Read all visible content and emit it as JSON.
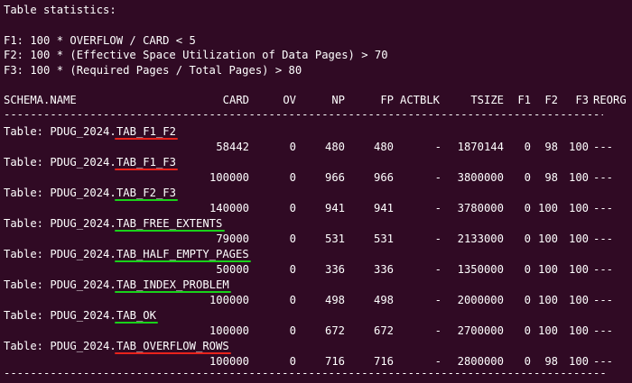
{
  "title": "Table statistics:",
  "formulas": [
    "F1: 100 * OVERFLOW / CARD < 5",
    "F2: 100 * (Effective Space Utilization of Data Pages) > 70",
    "F3: 100 * (Required Pages / Total Pages) > 80"
  ],
  "header": {
    "schema": "SCHEMA.NAME",
    "card": "CARD",
    "ov": "OV",
    "np": "NP",
    "fp": "FP",
    "actblk": "ACTBLK",
    "tsize": "TSIZE",
    "f1": "F1",
    "f2": "F2",
    "f3": "F3",
    "reorg": "REORG"
  },
  "separator": "-------------------------------------------------------------------------------------------",
  "colors": {
    "background": "#300a24",
    "text": "#ffffff",
    "fail_underline": "#e8231c",
    "ok_underline": "#19d21a"
  },
  "rows": [
    {
      "prefix": "Table: PDUG_2024.",
      "name": "TAB_F1_F2",
      "underline": "red",
      "card": "58442",
      "ov": "0",
      "np": "480",
      "fp": "480",
      "actblk": "-",
      "tsize": "1870144",
      "f1": "0",
      "f2": "98",
      "f3": "100",
      "reorg": "---"
    },
    {
      "prefix": "Table: PDUG_2024.",
      "name": "TAB_F1_F3",
      "underline": "red",
      "card": "100000",
      "ov": "0",
      "np": "966",
      "fp": "966",
      "actblk": "-",
      "tsize": "3800000",
      "f1": "0",
      "f2": "98",
      "f3": "100",
      "reorg": "---"
    },
    {
      "prefix": "Table: PDUG_2024.",
      "name": "TAB_F2_F3",
      "underline": "green",
      "card": "140000",
      "ov": "0",
      "np": "941",
      "fp": "941",
      "actblk": "-",
      "tsize": "3780000",
      "f1": "0",
      "f2": "100",
      "f3": "100",
      "reorg": "---"
    },
    {
      "prefix": "Table: PDUG_2024.",
      "name": "TAB_FREE_EXTENTS",
      "underline": "green",
      "card": "79000",
      "ov": "0",
      "np": "531",
      "fp": "531",
      "actblk": "-",
      "tsize": "2133000",
      "f1": "0",
      "f2": "100",
      "f3": "100",
      "reorg": "---"
    },
    {
      "prefix": "Table: PDUG_2024.",
      "name": "TAB_HALF_EMPTY_PAGES",
      "underline": "green",
      "card": "50000",
      "ov": "0",
      "np": "336",
      "fp": "336",
      "actblk": "-",
      "tsize": "1350000",
      "f1": "0",
      "f2": "100",
      "f3": "100",
      "reorg": "---"
    },
    {
      "prefix": "Table: PDUG_2024.",
      "name": "TAB_INDEX_PROBLEM",
      "underline": "green",
      "card": "100000",
      "ov": "0",
      "np": "498",
      "fp": "498",
      "actblk": "-",
      "tsize": "2000000",
      "f1": "0",
      "f2": "100",
      "f3": "100",
      "reorg": "---"
    },
    {
      "prefix": "Table: PDUG_2024.",
      "name": "TAB_OK",
      "underline": "green",
      "card": "100000",
      "ov": "0",
      "np": "672",
      "fp": "672",
      "actblk": "-",
      "tsize": "2700000",
      "f1": "0",
      "f2": "100",
      "f3": "100",
      "reorg": "---"
    },
    {
      "prefix": "Table: PDUG_2024.",
      "name": "TAB_OVERFLOW_ROWS",
      "underline": "red",
      "card": "100000",
      "ov": "0",
      "np": "716",
      "fp": "716",
      "actblk": "-",
      "tsize": "2800000",
      "f1": "0",
      "f2": "98",
      "f3": "100",
      "reorg": "---"
    }
  ]
}
